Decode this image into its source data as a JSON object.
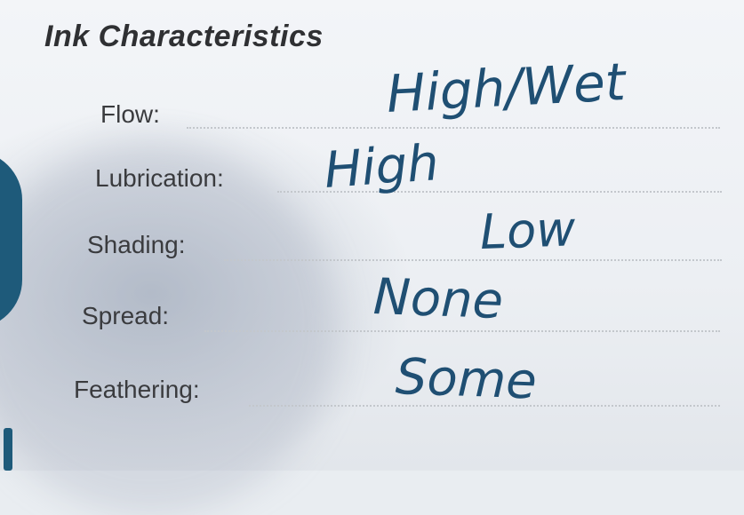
{
  "title": "Ink Characteristics",
  "fields": [
    {
      "label": "Flow:",
      "value": "High/Wet"
    },
    {
      "label": "Lubrication:",
      "value": "High"
    },
    {
      "label": "Shading:",
      "value": "Low"
    },
    {
      "label": "Spread:",
      "value": "None"
    },
    {
      "label": "Feathering:",
      "value": "Some"
    }
  ],
  "colors": {
    "ink": "#1f4f73",
    "paper": "#eef1f4",
    "print": "#3a3b3e"
  }
}
